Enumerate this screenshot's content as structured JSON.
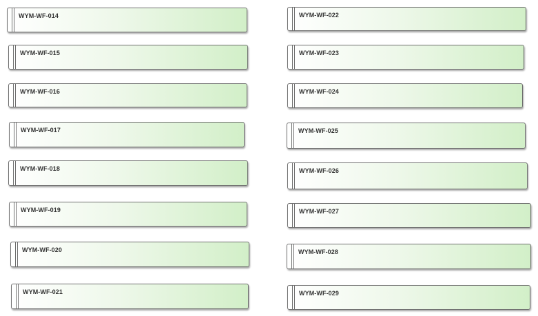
{
  "diagram": {
    "nodes": [
      {
        "id": "n014",
        "label": "WYM-WF-014"
      },
      {
        "id": "n015",
        "label": "WYM-WF-015"
      },
      {
        "id": "n016",
        "label": "WYM-WF-016"
      },
      {
        "id": "n017",
        "label": "WYM-WF-017"
      },
      {
        "id": "n018",
        "label": "WYM-WF-018"
      },
      {
        "id": "n019",
        "label": "WYM-WF-019"
      },
      {
        "id": "n020",
        "label": "WYM-WF-020"
      },
      {
        "id": "n021",
        "label": "WYM-WF-021"
      },
      {
        "id": "n022",
        "label": "WYM-WF-022"
      },
      {
        "id": "n023",
        "label": "WYM-WF-023"
      },
      {
        "id": "n024",
        "label": "WYM-WF-024"
      },
      {
        "id": "n025",
        "label": "WYM-WF-025"
      },
      {
        "id": "n026",
        "label": "WYM-WF-026"
      },
      {
        "id": "n027",
        "label": "WYM-WF-027"
      },
      {
        "id": "n028",
        "label": "WYM-WF-028"
      },
      {
        "id": "n029",
        "label": "WYM-WF-029"
      }
    ],
    "colors": {
      "fill_start": "#ffffff",
      "fill_end": "#d2efc8",
      "border": "#6f6f6f",
      "text": "#333333"
    }
  }
}
